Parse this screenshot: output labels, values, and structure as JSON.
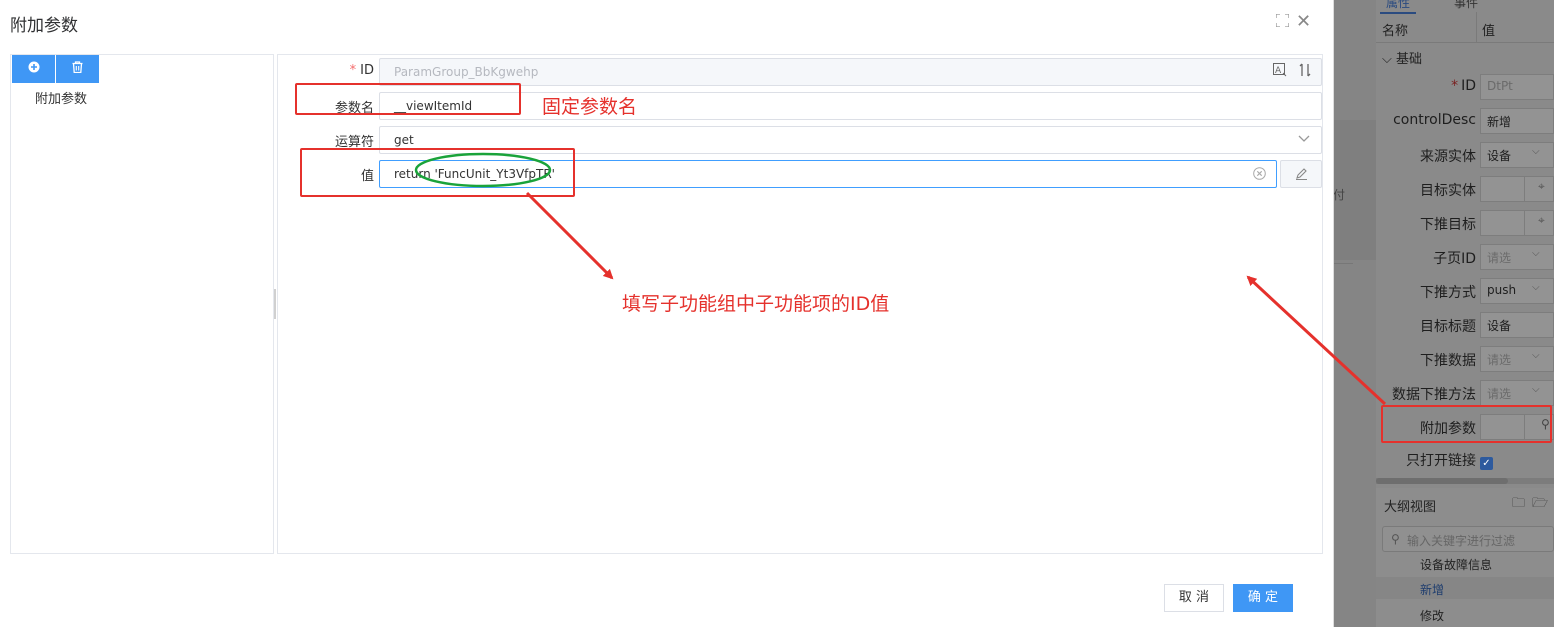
{
  "modal": {
    "title": "附加参数",
    "toolbar": {
      "add_icon": "plus-circle-icon",
      "delete_icon": "trash-icon"
    },
    "tree": {
      "items": [
        "附加参数"
      ]
    },
    "form": {
      "id": {
        "label": "ID",
        "required": true,
        "value": "ParamGroup_BbKgwehp"
      },
      "param_name": {
        "label": "参数名",
        "value": "__viewItemId"
      },
      "operator": {
        "label": "运算符",
        "value": "get"
      },
      "value": {
        "label": "值",
        "value": "return 'FuncUnit_Yt3VfpTR'"
      }
    },
    "footer": {
      "cancel": "取 消",
      "ok": "确 定"
    }
  },
  "annotations": {
    "fixed_param_name": "固定参数名",
    "fill_id_hint": "填写子功能组中子功能项的ID值",
    "color": "#e5312c",
    "ellipse_color": "#1aa33a"
  },
  "right_panel": {
    "tabs": [
      "属性",
      "事件"
    ],
    "header": {
      "name": "名称",
      "value": "值"
    },
    "group": "基础",
    "rows": [
      {
        "label": "ID",
        "required": true,
        "value": "DtPt",
        "dim": true
      },
      {
        "label": "controlDesc",
        "value": "新增"
      },
      {
        "label": "来源实体",
        "value": "设备",
        "chevron": true
      },
      {
        "label": "目标实体",
        "value": "",
        "pin": true
      },
      {
        "label": "下推目标",
        "value": "",
        "pin": true
      },
      {
        "label": "子页ID",
        "value": "请选",
        "dim": true,
        "chevron": true
      },
      {
        "label": "下推方式",
        "value": "push",
        "chevron": true
      },
      {
        "label": "目标标题",
        "value": "设备"
      },
      {
        "label": "下推数据",
        "value": "请选",
        "dim": true,
        "chevron": true
      },
      {
        "label": "数据下推方法",
        "value": "请选",
        "dim": true,
        "chevron": true
      },
      {
        "label": "附加参数",
        "value": "",
        "search": true
      }
    ],
    "checkbox_label": "只打开链接",
    "outline": {
      "title": "大纲视图",
      "search_placeholder": "输入关键字进行过滤",
      "items": [
        "设备故障信息",
        "新增",
        "修改"
      ],
      "selected": "新增"
    },
    "ghost_text": "付"
  }
}
